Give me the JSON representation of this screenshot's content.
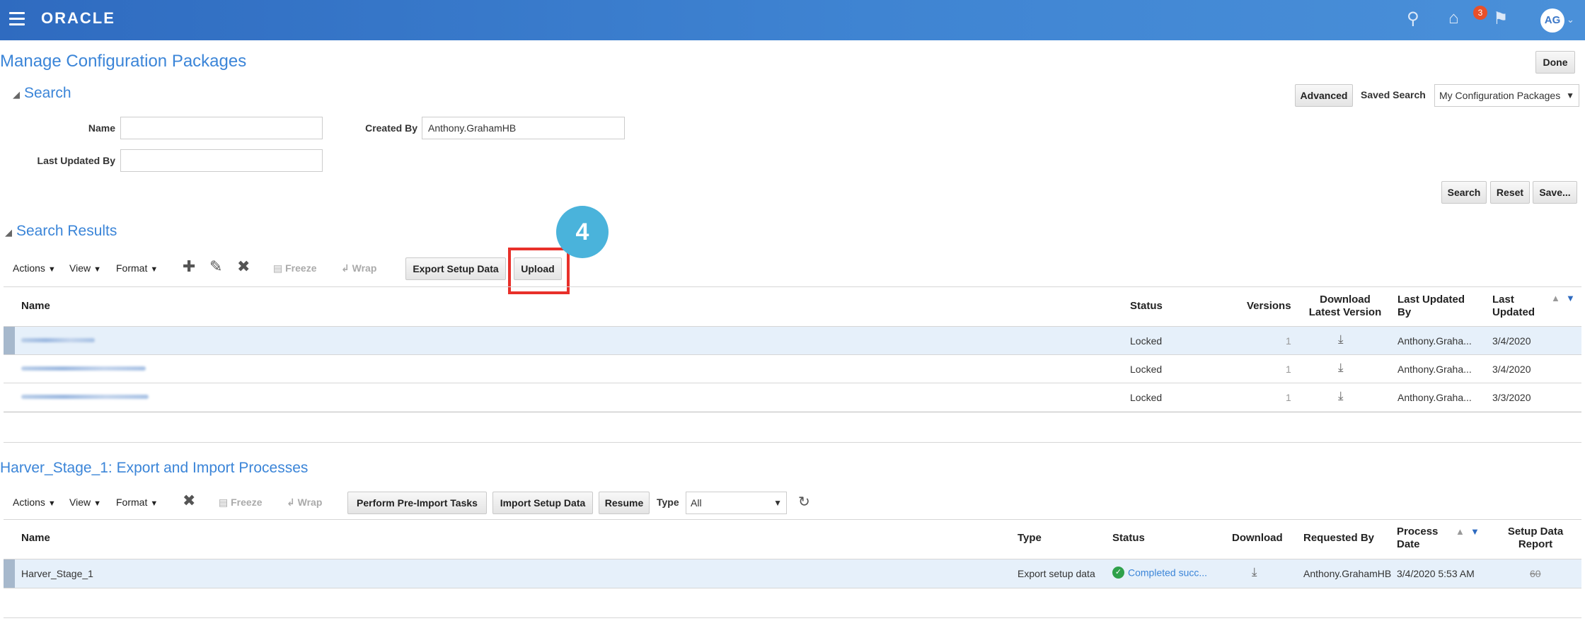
{
  "topbar": {
    "logo": "ORACLE",
    "notifications_count": "3",
    "avatar_initials": "AG",
    "icons": [
      "menu-icon",
      "search-icon",
      "home-icon",
      "notifications-icon",
      "chevron-down-icon"
    ]
  },
  "page": {
    "title": "Manage Configuration Packages",
    "done_label": "Done"
  },
  "search": {
    "title": "Search",
    "advanced_label": "Advanced",
    "saved_search_label": "Saved Search",
    "saved_search_value": "My Configuration Packages",
    "name_label": "Name",
    "name_value": "",
    "created_by_label": "Created By",
    "created_by_value": "Anthony.GrahamHB",
    "last_updated_by_label": "Last Updated By",
    "last_updated_by_value": "",
    "search_button": "Search",
    "reset_button": "Reset",
    "save_button": "Save..."
  },
  "results": {
    "title": "Search Results",
    "toolbar": {
      "actions": "Actions",
      "view": "View",
      "format": "Format",
      "freeze": "Freeze",
      "wrap": "Wrap",
      "export_button": "Export Setup Data",
      "upload_button": "Upload"
    },
    "callout_number": "4",
    "columns": {
      "name": "Name",
      "status": "Status",
      "versions": "Versions",
      "download_line1": "Download",
      "download_line2": "Latest Version",
      "last_updated_by_line1": "Last Updated",
      "last_updated_by_line2": "By",
      "last_updated_line1": "Last",
      "last_updated_line2": "Updated"
    },
    "rows": [
      {
        "status": "Locked",
        "versions": "1",
        "updated_by": "Anthony.Graha...",
        "updated": "3/4/2020"
      },
      {
        "status": "Locked",
        "versions": "1",
        "updated_by": "Anthony.Graha...",
        "updated": "3/4/2020"
      },
      {
        "status": "Locked",
        "versions": "1",
        "updated_by": "Anthony.Graha...",
        "updated": "3/3/2020"
      }
    ]
  },
  "processes": {
    "title": "Harver_Stage_1: Export and Import Processes",
    "toolbar": {
      "actions": "Actions",
      "view": "View",
      "format": "Format",
      "freeze": "Freeze",
      "wrap": "Wrap",
      "pre_import_button": "Perform Pre-Import Tasks",
      "import_button": "Import Setup Data",
      "resume_button": "Resume",
      "type_label": "Type",
      "type_value": "All"
    },
    "columns": {
      "name": "Name",
      "type": "Type",
      "status": "Status",
      "download": "Download",
      "requested_by": "Requested By",
      "process_date_line1": "Process",
      "process_date_line2": "Date",
      "report_line1": "Setup Data",
      "report_line2": "Report"
    },
    "rows": [
      {
        "name": "Harver_Stage_1",
        "type": "Export setup data",
        "status": "Completed succ...",
        "requested_by": "Anthony.GrahamHB",
        "process_date": "3/4/2020 5:53 AM",
        "report": "60"
      }
    ]
  },
  "colors": {
    "header_blue": "#3f84d2",
    "title_blue": "#3b85d8",
    "callout": "#4ab3db",
    "highlight_box": "#e8302a",
    "selected_row": "#e6f0fa",
    "success_green": "#2fa14a"
  }
}
